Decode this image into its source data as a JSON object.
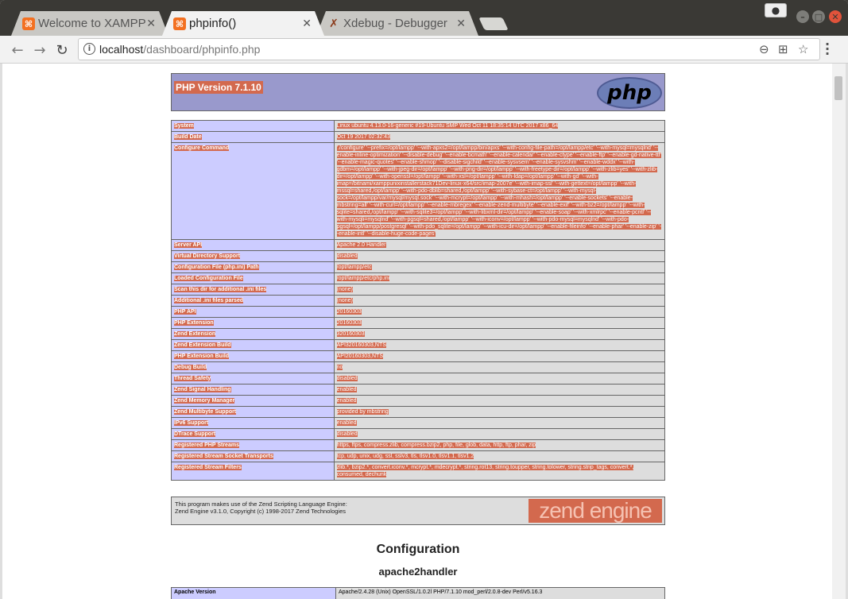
{
  "tabs": [
    {
      "title": "Welcome to XAMPP",
      "favicon": "xampp-icon",
      "active": false
    },
    {
      "title": "phpinfo()",
      "favicon": "xampp-icon",
      "active": true
    },
    {
      "title": "Xdebug - Debugger",
      "favicon": "xdebug-icon",
      "active": false
    }
  ],
  "toolbar": {
    "url_host": "localhost",
    "url_path": "/dashboard/phpinfo.php"
  },
  "page": {
    "version_heading": "PHP Version 7.1.10",
    "php_logo_text": "php",
    "rows": [
      {
        "label": "System",
        "value": "Linux ubuntu 4.13.0-16-generic #19-Ubuntu SMP Wed Oct 11 18:35:14 UTC 2017 x86_64"
      },
      {
        "label": "Build Date",
        "value": "Oct 19 2017 02:32:43"
      },
      {
        "label": "Configure Command",
        "value": "'./configure' '--prefix=/opt/lampp' '--with-apxs2=/opt/lampp/bin/apxs' '--with-config-file-path=/opt/lampp/etc' '--with-mysql=mysqlnd' '--enable-inline-optimization' '--disable-debug' '--enable-bcmath' '--enable-calendar' '--enable-ctype' '--enable-ftp' '--enable-gd-native-ttf' '--enable-magic-quotes' '--enable-shmop' '--disable-sigchild' '--enable-sysvsem' '--enable-sysvshm' '--enable-wddx' '--with-gdbm=/opt/lampp' '--with-jpeg-dir=/opt/lampp' '--with-png-dir=/opt/lampp' '--with-freetype-dir=/opt/lampp' '--with-zlib=yes' '--with-zlib-dir=/opt/lampp' '--with-openssl=/opt/lampp' '--with-xsl=/opt/lampp' '--with-ldap=/opt/lampp' '--with-gd' '--with-imap=/bitnami/xamppunixinstallerstack71Dev-linux-x64/src/imap-2007e' '--with-imap-ssl' '--with-gettext=/opt/lampp' '--with-mssql=shared,/opt/lampp' '--with-pdo-dblib=shared,/opt/lampp' '--with-sybase-ct=/opt/lampp' '--with-mysql-sock=/opt/lampp/var/mysql/mysql.sock' '--with-mcrypt=/opt/lampp' '--with-mhash=/opt/lampp' '--enable-sockets' '--enable-mbstring=all' '--with-curl=/opt/lampp' '--enable-mbregex' '--enable-zend-multibyte' '--enable-exif' '--with-bz2=/opt/lampp' '--with-sqlite=shared,/opt/lampp' '--with-sqlite3=/opt/lampp' '--with-libxml-dir=/opt/lampp' '--enable-soap' '--with-xmlrpc' '--enable-pcntl' '--with-mysqli=mysqlnd' '--with-pgsql=shared,/opt/lampp' '--with-iconv=/opt/lampp' '--with-pdo-mysql=mysqlnd' '--with-pdo-pgsql=/opt/lampp/postgresql' '--with-pdo_sqlite=/opt/lampp' '--with-icu-dir=/opt/lampp' '--enable-fileinfo' '--enable-phar' '--enable-zip' '--enable-intl' '--disable-huge-code-pages'"
      },
      {
        "label": "Server API",
        "value": "Apache 2.0 Handler"
      },
      {
        "label": "Virtual Directory Support",
        "value": "disabled"
      },
      {
        "label": "Configuration File (php.ini) Path",
        "value": "/opt/lampp/etc"
      },
      {
        "label": "Loaded Configuration File",
        "value": "/opt/lampp/etc/php.ini"
      },
      {
        "label": "Scan this dir for additional .ini files",
        "value": "(none)"
      },
      {
        "label": "Additional .ini files parsed",
        "value": "(none)"
      },
      {
        "label": "PHP API",
        "value": "20160303"
      },
      {
        "label": "PHP Extension",
        "value": "20160303"
      },
      {
        "label": "Zend Extension",
        "value": "320160303"
      },
      {
        "label": "Zend Extension Build",
        "value": "API320160303,NTS"
      },
      {
        "label": "PHP Extension Build",
        "value": "API20160303,NTS"
      },
      {
        "label": "Debug Build",
        "value": "no"
      },
      {
        "label": "Thread Safety",
        "value": "disabled"
      },
      {
        "label": "Zend Signal Handling",
        "value": "enabled"
      },
      {
        "label": "Zend Memory Manager",
        "value": "enabled"
      },
      {
        "label": "Zend Multibyte Support",
        "value": "provided by mbstring"
      },
      {
        "label": "IPv6 Support",
        "value": "enabled"
      },
      {
        "label": "DTrace Support",
        "value": "disabled"
      },
      {
        "label": "Registered PHP Streams",
        "value": "https, ftps, compress.zlib, compress.bzip2, php, file, glob, data, http, ftp, phar, zip"
      },
      {
        "label": "Registered Stream Socket Transports",
        "value": "tcp, udp, unix, udg, ssl, sslv3, tls, tlsv1.0, tlsv1.1, tlsv1.2"
      },
      {
        "label": "Registered Stream Filters",
        "value": "zlib.*, bzip2.*, convert.iconv.*, mcrypt.*, mdecrypt.*, string.rot13, string.toupper, string.tolower, string.strip_tags, convert.*, consumed, dechunk"
      }
    ],
    "zend_text_line1": "This program makes use of the Zend Scripting Language Engine:",
    "zend_text_line2": "Zend Engine v3.1.0, Copyright (c) 1998-2017 Zend Technologies",
    "zend_logo_text": "zend engine",
    "configuration_heading": "Configuration",
    "apache_heading": "apache2handler",
    "next_row_label": "Apache Version",
    "next_row_value": "Apache/2.4.28 (Unix) OpenSSL/1.0.2l PHP/7.1.10 mod_perl/2.0.8-dev Perl/v5.16.3"
  }
}
